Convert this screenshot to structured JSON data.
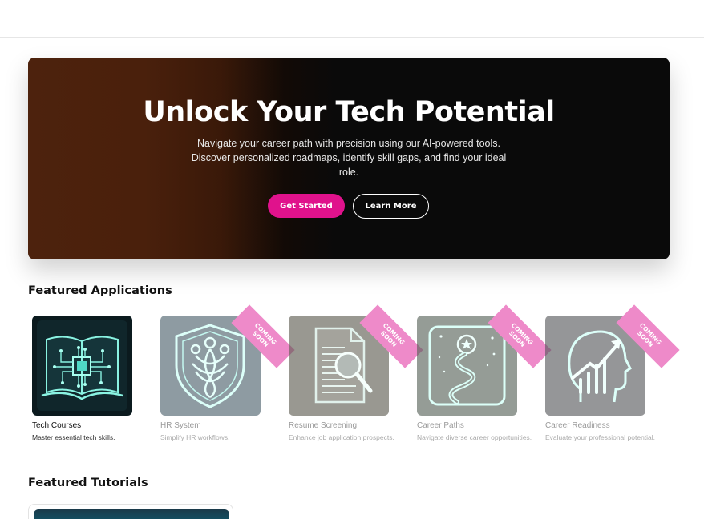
{
  "hero": {
    "title": "Unlock Your Tech Potential",
    "subtitle": "Navigate your career path with precision using our AI-powered tools. Discover personalized roadmaps, identify skill gaps, and find your ideal role.",
    "primary_button": "Get Started",
    "secondary_button": "Learn More"
  },
  "featured_apps": {
    "title": "Featured Applications",
    "items": [
      {
        "name": "Tech Courses",
        "description": "Master essential tech skills.",
        "icon": "book-circuit-icon",
        "coming_soon": false
      },
      {
        "name": "HR System",
        "description": "Simplify HR workflows.",
        "icon": "people-shield-icon",
        "coming_soon": true,
        "badge": "COMING SOON"
      },
      {
        "name": "Resume Screening",
        "description": "Enhance job application prospects.",
        "icon": "document-magnifier-icon",
        "coming_soon": true,
        "badge": "COMING SOON"
      },
      {
        "name": "Career Paths",
        "description": "Navigate diverse career opportunities.",
        "icon": "winding-path-icon",
        "coming_soon": true,
        "badge": "COMING SOON"
      },
      {
        "name": "Career Readiness",
        "description": "Evaluate your professional potential.",
        "icon": "head-growth-icon",
        "coming_soon": true,
        "badge": "COMING SOON"
      }
    ]
  },
  "featured_tutorials": {
    "title": "Featured Tutorials"
  },
  "colors": {
    "accent": "#e0128c",
    "badge": "#ee8ac9",
    "hero_dark": "#0a0a0a",
    "hero_brown": "#4d220d",
    "neon": "#7ff5e6"
  }
}
